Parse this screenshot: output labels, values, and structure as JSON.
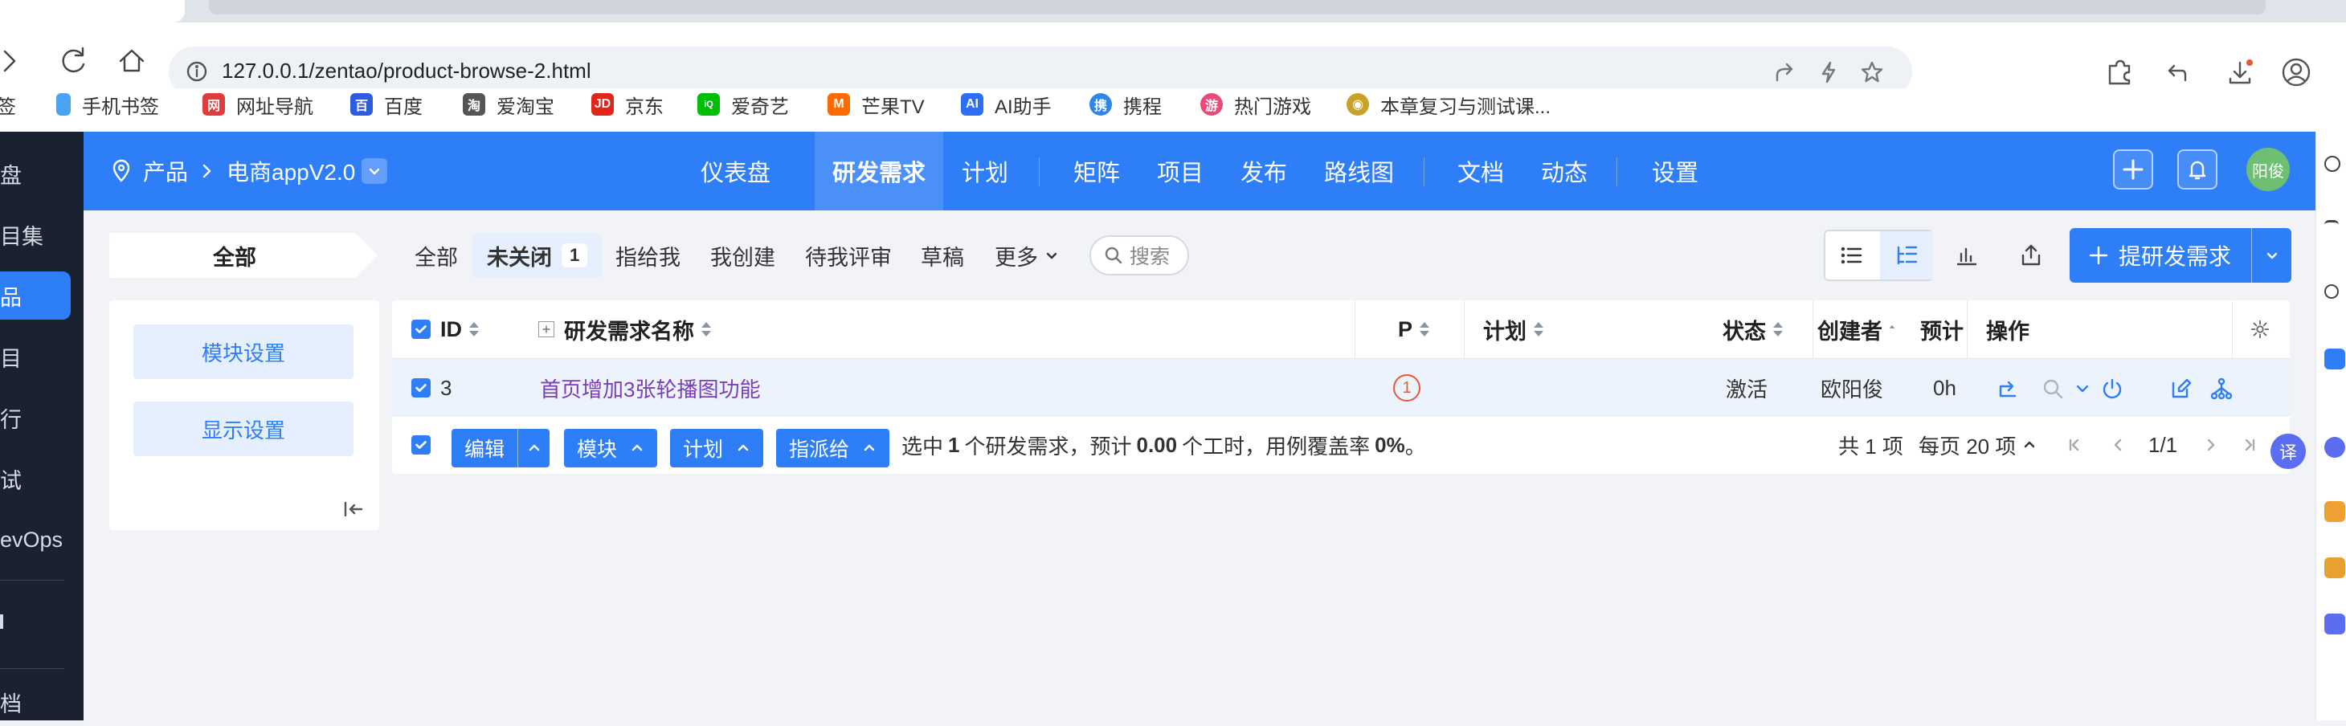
{
  "browser": {
    "url": "127.0.0.1/zentao/product-browse-2.html",
    "bookmarks": [
      {
        "label": "签",
        "icon": "folder-icon"
      },
      {
        "label": "手机书签",
        "icon": "phone-bookmark-icon",
        "color": "#4aa3f0"
      },
      {
        "label": "网址导航",
        "icon": "nav-icon",
        "color": "#e23b3b"
      },
      {
        "label": "百度",
        "icon": "baidu-paw-icon",
        "color": "#2e5be0"
      },
      {
        "label": "爱淘宝",
        "icon": "taobao-icon",
        "color": "#555555"
      },
      {
        "label": "京东",
        "icon": "jd-icon",
        "color": "#e1251b"
      },
      {
        "label": "爱奇艺",
        "icon": "iqiyi-icon",
        "color": "#00be06"
      },
      {
        "label": "芒果TV",
        "icon": "mangotv-icon",
        "color": "#ff6a00"
      },
      {
        "label": "AI助手",
        "icon": "ai-assistant-icon",
        "color": "#2d6ef5"
      },
      {
        "label": "携程",
        "icon": "ctrip-icon",
        "color": "#2f86e8"
      },
      {
        "label": "热门游戏",
        "icon": "game-icon",
        "color": "#e84a7a"
      },
      {
        "label": "本章复习与测试课...",
        "icon": "owl-icon",
        "color": "#c9a227"
      }
    ]
  },
  "sidebar": {
    "items": [
      {
        "label": "盘"
      },
      {
        "label": "目集"
      },
      {
        "label": "品",
        "active": true
      },
      {
        "label": "目"
      },
      {
        "label": "行"
      },
      {
        "label": "试"
      },
      {
        "label": "evOps"
      },
      {
        "label": ""
      },
      {
        "label": "档"
      }
    ]
  },
  "header": {
    "breadcrumb_root": "产品",
    "product": "电商appV2.0",
    "nav": [
      "仪表盘",
      "研发需求",
      "计划",
      "矩阵",
      "项目",
      "发布",
      "路线图",
      "文档",
      "动态",
      "设置"
    ],
    "active_nav": "研发需求",
    "avatar": "阳俊"
  },
  "toolbar": {
    "segment": "全部",
    "filters": [
      "全部",
      "未关闭",
      "指给我",
      "我创建",
      "待我评审",
      "草稿",
      "更多"
    ],
    "unclosed_count": "1",
    "search_placeholder": "搜索",
    "create_label": "提研发需求"
  },
  "left_panel": {
    "module_settings": "模块设置",
    "display_settings": "显示设置"
  },
  "table": {
    "columns": [
      "ID",
      "研发需求名称",
      "P",
      "计划",
      "状态",
      "创建者",
      "预计",
      "操作"
    ],
    "rows": [
      {
        "id": "3",
        "name": "首页增加3张轮播图功能",
        "priority": "1",
        "plan": "",
        "status": "激活",
        "creator": "欧阳俊",
        "estimate": "0h"
      }
    ]
  },
  "footer": {
    "buttons": [
      "编辑",
      "模块",
      "计划",
      "指派给"
    ],
    "summary_pre": "选中",
    "selected": "1",
    "summary_mid": "个研发需求，预计",
    "hours": "0.00",
    "summary_mid2": "个工时，用例覆盖率",
    "coverage": "0%",
    "summary_end": "。",
    "total": "共 1 项",
    "per_page": "每页 20 项",
    "page": "1/1"
  },
  "colors": {
    "primary": "#2e7ef8",
    "sidebar": "#1a2131",
    "danger": "#e8573a"
  }
}
